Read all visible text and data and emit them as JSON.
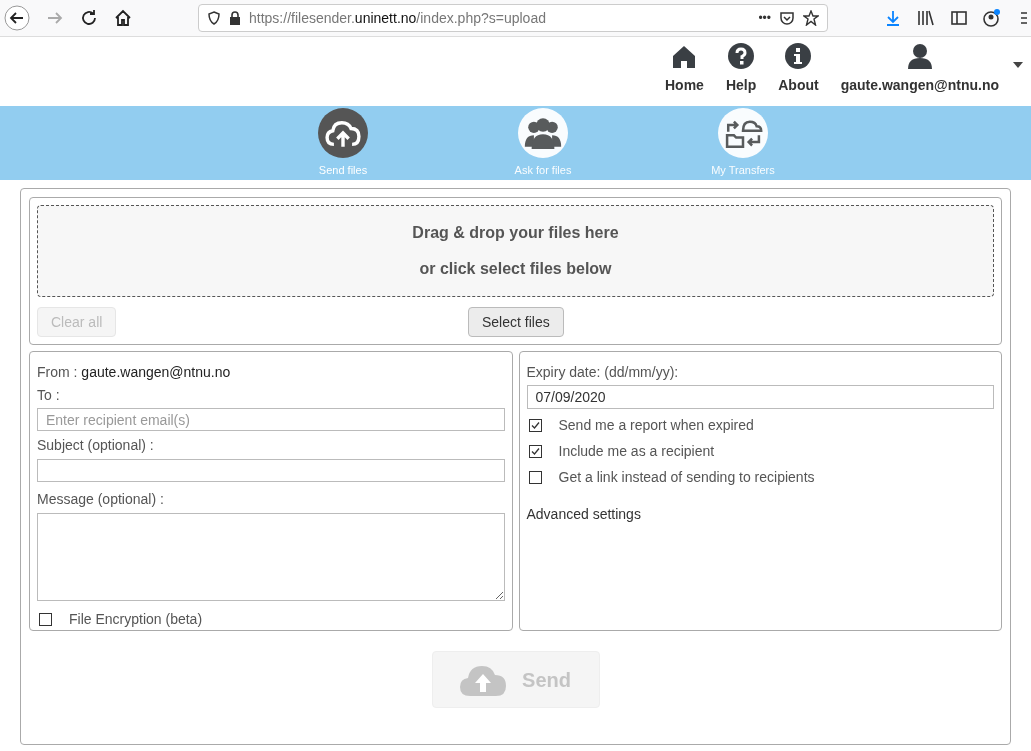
{
  "browser": {
    "url": {
      "scheme_host_start": "https://filesender.",
      "domain": "uninett.no",
      "path": "/index.php?s=upload"
    },
    "menu_dots": "•••"
  },
  "header": {
    "links": [
      {
        "kind": "home",
        "label": "Home"
      },
      {
        "kind": "help",
        "label": "Help"
      },
      {
        "kind": "about",
        "label": "About"
      },
      {
        "kind": "user",
        "label": "gaute.wangen@ntnu.no"
      }
    ]
  },
  "nav": [
    {
      "kind": "send",
      "label": "Send files",
      "selected": true
    },
    {
      "kind": "ask",
      "label": "Ask for files",
      "selected": false
    },
    {
      "kind": "transfers",
      "label": "My Transfers",
      "selected": false
    }
  ],
  "dropzone": {
    "lines": [
      "Drag & drop your files here",
      "or click select files below"
    ]
  },
  "buttons": {
    "clear": {
      "label": "Clear all",
      "disabled": true
    },
    "select": {
      "label": "Select files",
      "disabled": false
    },
    "send": {
      "label": "Send",
      "disabled": true
    }
  },
  "left": {
    "from_label": "From :",
    "from_value": "gaute.wangen@ntnu.no",
    "to_label": "To :",
    "to_placeholder": "Enter recipient email(s)",
    "subject_label": "Subject (optional) :",
    "message_label": "Message (optional) :",
    "encryption": {
      "label": "File Encryption (beta)",
      "checked": false
    }
  },
  "right": {
    "expiry_label": "Expiry date: (dd/mm/yy):",
    "expiry_value": "07/09/2020",
    "options": [
      {
        "label": "Send me a report when expired",
        "checked": true
      },
      {
        "label": "Include me as a recipient",
        "checked": true
      },
      {
        "label": "Get a link instead of sending to recipients",
        "checked": false
      }
    ],
    "advanced": "Advanced settings"
  }
}
